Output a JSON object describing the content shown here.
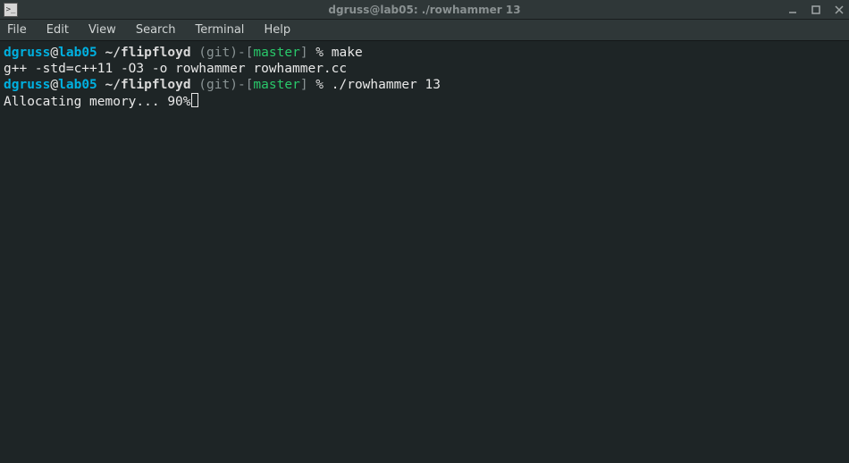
{
  "title": "dgruss@lab05: ./rowhammer 13",
  "menubar": [
    "File",
    "Edit",
    "View",
    "Search",
    "Terminal",
    "Help"
  ],
  "prompt": {
    "user": "dgruss",
    "host": "lab05",
    "path": "~/flipfloyd",
    "vcs_open": " (",
    "vcs_label": "git",
    "vcs_close": ")",
    "dash": "-",
    "lbrack": "[",
    "branch": "master",
    "rbrack": "]",
    "symbol": "%"
  },
  "lines": {
    "cmd1": "make",
    "out1": "g++ -std=c++11 -O3 -o rowhammer rowhammer.cc",
    "cmd2": "./rowhammer 13",
    "out2": "Allocating memory... 90%"
  }
}
